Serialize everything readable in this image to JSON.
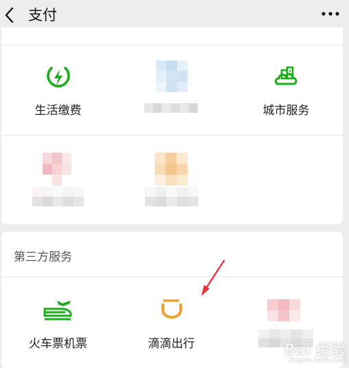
{
  "header": {
    "title": "支付",
    "back_icon": "chevron-left-icon",
    "more_icon": "more-horizontal-icon"
  },
  "services": {
    "items": [
      {
        "label": "生活缴费",
        "icon": "lightning-icon"
      },
      {
        "label": "城市服务",
        "icon": "city-icon"
      }
    ]
  },
  "third_party": {
    "title": "第三方服务",
    "items": [
      {
        "label": "火车票机票",
        "icon": "train-icon"
      },
      {
        "label": "滴滴出行",
        "icon": "didi-icon"
      }
    ]
  },
  "watermark": {
    "text": "Bai 经验",
    "sub": "jingyan.baidu.com"
  },
  "colors": {
    "green": "#1aad19",
    "didi_orange": "#f59e2c",
    "arrow_red": "#e8343a"
  }
}
